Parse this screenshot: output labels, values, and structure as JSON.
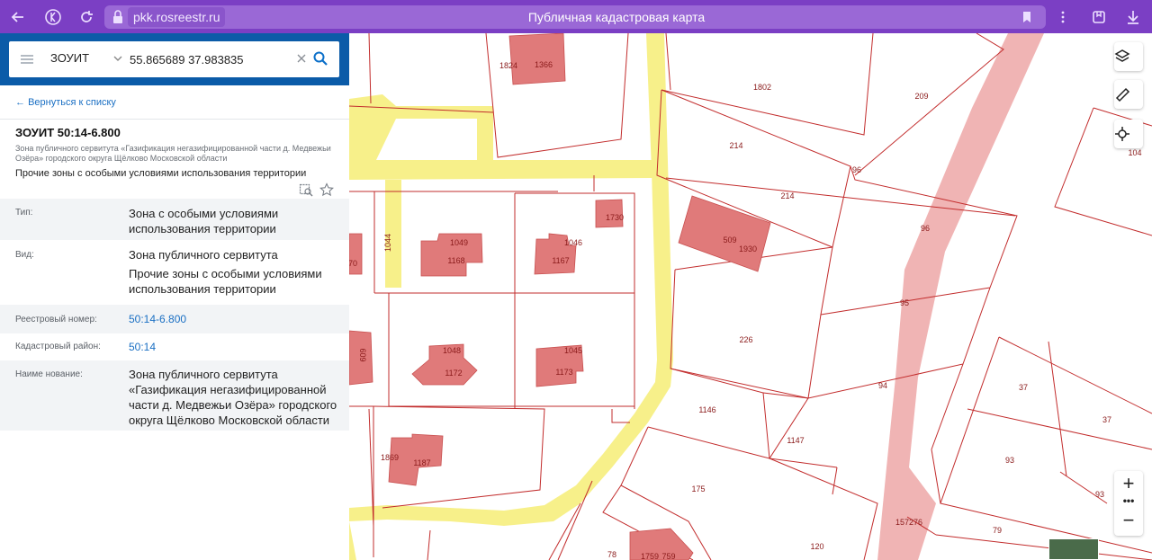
{
  "browser": {
    "domain": "pkk.rosreestr.ru",
    "title": "Публичная кадастровая карта"
  },
  "search": {
    "type_label": "ЗОУИТ",
    "query": "55.865689 37.983835"
  },
  "card": {
    "back_link": "Вернуться к списку",
    "title": "ЗОУИТ 50:14-6.800",
    "subtitle": "Зона публичного сервитута «Газификация негазифицированной части д. Медвежьи Озёра» городского округа Щёлково Московской области",
    "category": "Прочие зоны с особыми условиями использования территории",
    "fields": {
      "type_label": "Тип:",
      "type_value": "Зона с особыми условиями использования территории",
      "kind_label": "Вид:",
      "kind_value_1": "Зона публичного сервитута",
      "kind_value_2": "Прочие зоны с особыми условиями использования территории",
      "reg_label": "Реестровый номер:",
      "reg_value": "50:14-6.800",
      "district_label": "Кадастровый район:",
      "district_value": "50:14",
      "name_label": "Наиме нование:",
      "name_value": "Зона публичного сервитута «Газификация негазифицированной части д. Медвежьи Озёра» городского округа Щёлково Московской области"
    }
  },
  "map": {
    "labels": {
      "p1824": "1824",
      "p1366": "1366",
      "p1802": "1802",
      "p209": "209",
      "p214a": "214",
      "p214b": "214",
      "p96a": "96",
      "p96b": "96",
      "p104": "104",
      "p509": "509",
      "p1930": "1930",
      "p1730": "1730",
      "p1044": "1044",
      "p1049": "1049",
      "p1168": "1168",
      "p1046": "1046",
      "p1167": "1167",
      "p95": "95",
      "p226": "226",
      "p1048": "1048",
      "p1172": "1172",
      "p1045": "1045",
      "p1173": "1173",
      "p94": "94",
      "p37a": "37",
      "p37b": "37",
      "p1146": "1146",
      "p1147": "1147",
      "p93a": "93",
      "p93b": "93",
      "p1869": "1869",
      "p1187": "1187",
      "p175": "175",
      "p157276": "157276",
      "p79": "79",
      "p78": "78",
      "p120": "120",
      "p1759": "1759",
      "p1759b": "759",
      "pl609": "609",
      "pl70": "70"
    }
  },
  "colors": {
    "browser_bar": "#7b3fc4",
    "panel_header": "#0b5ba8",
    "parcel_border": "#c22c2c",
    "building_fill": "#e07a7a",
    "servitude_zone": "#f7f08a",
    "road_zone": "#f0b4b4"
  },
  "icons": {
    "back": "back-arrow-icon",
    "yandex": "yandex-icon",
    "reload": "reload-icon",
    "lock": "lock-icon",
    "bookmark": "bookmark-icon",
    "more": "more-vert-icon",
    "collections": "collections-icon",
    "download": "download-icon",
    "menu": "hamburger-icon",
    "search": "search-icon",
    "layers": "layers-icon",
    "ruler": "ruler-icon",
    "locate": "locate-icon",
    "zoom_in": "plus-icon",
    "zoom_out": "minus-icon"
  }
}
